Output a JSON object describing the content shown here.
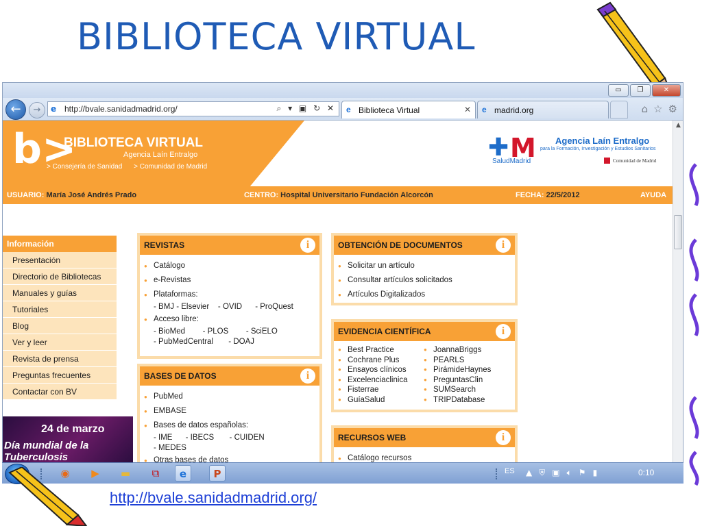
{
  "slide": {
    "title": "BIBLIOTECA VIRTUAL",
    "link": "http://bvale.sanidadmadrid.org/"
  },
  "browser": {
    "address": "http://bvale.sanidadmadrid.org/",
    "address_tools": "⌕ ▾ ▣ ↻ ✕",
    "tabs": [
      {
        "label": "Biblioteca Virtual",
        "active": true
      },
      {
        "label": "madrid.org",
        "active": false
      }
    ],
    "window_buttons": {
      "minimize": "▭",
      "maximize": "❐",
      "close": "✕"
    },
    "nav_icons": [
      "home-icon",
      "star-icon",
      "gear-icon"
    ]
  },
  "header": {
    "logo_mark": "b>",
    "logo_title": "BIBLIOTECA VIRTUAL",
    "logo_subtitle": "Agencia Laín Entralgo",
    "logo_links": [
      "> Consejería de Sanidad",
      "> Comunidad de Madrid"
    ],
    "cm_logo": "M",
    "salud_madrid": "SaludMadrid",
    "agencia": "Agencia Laín Entralgo",
    "agencia_sub": "para la Formación, Investigación y Estudios Sanitarios",
    "comunidad": "Comunidad de Madrid"
  },
  "userbar": {
    "usuario_label": "USUARIO:",
    "usuario_value": "María José  Andrés Prado",
    "centro_label": "CENTRO:",
    "centro_value": "Hospital Universitario Fundación Alcorcón",
    "fecha_label": "FECHA:",
    "fecha_value": "22/5/2012",
    "ayuda": "AYUDA"
  },
  "menu": {
    "heading": "Información",
    "items": [
      "Presentación",
      "Directorio de Bibliotecas",
      "Manuales y guías",
      "Tutoriales",
      "Blog",
      "Ver y leer",
      "Revista de prensa",
      "Preguntas frecuentes",
      "Contactar con BV"
    ]
  },
  "banner": {
    "date": "24 de marzo",
    "text": "Día mundial de la Tuberculosis"
  },
  "revistas": {
    "title": "REVISTAS",
    "info": "i",
    "items": [
      "Catálogo",
      "e-Revistas",
      "Plataformas:"
    ],
    "plataformas": "- BMJ - Elsevier    - OVID      - ProQuest",
    "acceso_label": "Acceso libre:",
    "acceso_rows": [
      "- BioMed        - PLOS        - SciELO",
      "- PubMedCentral       - DOAJ"
    ]
  },
  "bases": {
    "title": "BASES DE DATOS",
    "info": "i",
    "items": [
      "PubMed",
      "EMBASE",
      "Bases de datos españolas:"
    ],
    "espanolas_rows": [
      "- IME      - IBECS       - CUIDEN",
      "- MEDES"
    ],
    "otras": "Otras bases de datos"
  },
  "obtencion": {
    "title": "OBTENCIÓN DE DOCUMENTOS",
    "info": "i",
    "items": [
      "Solicitar un artículo",
      "Consultar artículos solicitados",
      "Artículos Digitalizados"
    ]
  },
  "evidencia": {
    "title": "EVIDENCIA CIENTÍFICA",
    "info": "i",
    "col1": [
      "Best Practice",
      "Cochrane Plus",
      "Ensayos clínicos",
      "Excelenciaclinica",
      "Fisterrae",
      "GuíaSalud"
    ],
    "col2": [
      "JoannaBriggs",
      "PEARLS",
      "PirámideHaynes",
      "PreguntasClin",
      "SUMSearch",
      "TRIPDatabase"
    ]
  },
  "recursos": {
    "title": "RECURSOS WEB",
    "info": "i",
    "items": [
      "Catálogo recursos"
    ]
  },
  "taskbar": {
    "apps": [
      "firefox-icon",
      "media-player-icon",
      "folder-icon",
      "pdf-icon",
      "internet-explorer-icon",
      "powerpoint-icon"
    ],
    "lang": "ES",
    "clock": "0:10"
  },
  "colors": {
    "orange": "#f8a136",
    "title_blue": "#1f5bb5",
    "link_blue": "#1d3fd6"
  }
}
